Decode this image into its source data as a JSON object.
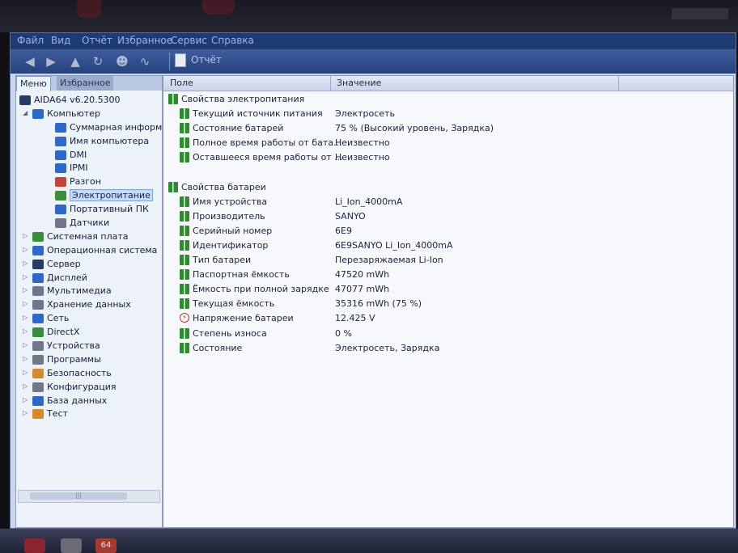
{
  "window": {
    "menu": [
      "Файл",
      "Вид",
      "Отчёт",
      "Избранное",
      "Сервис",
      "Справка"
    ],
    "toolbar": {
      "report_label": "Отчёт"
    }
  },
  "left_panel": {
    "tabs": [
      "Меню",
      "Избранное"
    ],
    "tree": [
      {
        "label": "AIDA64 v6.20.5300",
        "level": 0,
        "expander": "",
        "icon": "aida64-icon",
        "color": "#263b63"
      },
      {
        "label": "Компьютер",
        "level": 1,
        "expander": "◢",
        "icon": "computer-icon",
        "color": "#2f68c6"
      },
      {
        "label": "Суммарная информация",
        "level": 2,
        "expander": "",
        "icon": "summary-icon",
        "color": "#2f68c6"
      },
      {
        "label": "Имя компьютера",
        "level": 2,
        "expander": "",
        "icon": "computer-name-icon",
        "color": "#2f68c6"
      },
      {
        "label": "DMI",
        "level": 2,
        "expander": "",
        "icon": "dmi-icon",
        "color": "#2f68c6"
      },
      {
        "label": "IPMI",
        "level": 2,
        "expander": "",
        "icon": "ipmi-icon",
        "color": "#2f68c6"
      },
      {
        "label": "Разгон",
        "level": 2,
        "expander": "",
        "icon": "overclock-icon",
        "color": "#c3443b"
      },
      {
        "label": "Электропитание",
        "level": 2,
        "expander": "",
        "icon": "power-icon",
        "color": "#3a8d3b",
        "selected": true
      },
      {
        "label": "Портативный ПК",
        "level": 2,
        "expander": "",
        "icon": "laptop-icon",
        "color": "#2f68c6"
      },
      {
        "label": "Датчики",
        "level": 2,
        "expander": "",
        "icon": "sensor-icon",
        "color": "#6f7788"
      },
      {
        "label": "Системная плата",
        "level": 1,
        "expander": "▷",
        "icon": "motherboard-icon",
        "color": "#3a8d3b"
      },
      {
        "label": "Операционная система",
        "level": 1,
        "expander": "▷",
        "icon": "windows-icon",
        "color": "#2f68c6"
      },
      {
        "label": "Сервер",
        "level": 1,
        "expander": "▷",
        "icon": "server-icon",
        "color": "#263b63"
      },
      {
        "label": "Дисплей",
        "level": 1,
        "expander": "▷",
        "icon": "display-icon",
        "color": "#2f68c6"
      },
      {
        "label": "Мультимедиа",
        "level": 1,
        "expander": "▷",
        "icon": "multimedia-icon",
        "color": "#6f7788"
      },
      {
        "label": "Хранение данных",
        "level": 1,
        "expander": "▷",
        "icon": "storage-icon",
        "color": "#6f7788"
      },
      {
        "label": "Сеть",
        "level": 1,
        "expander": "▷",
        "icon": "network-icon",
        "color": "#2f68c6"
      },
      {
        "label": "DirectX",
        "level": 1,
        "expander": "▷",
        "icon": "directx-icon",
        "color": "#3a8d3b"
      },
      {
        "label": "Устройства",
        "level": 1,
        "expander": "▷",
        "icon": "devices-icon",
        "color": "#6f7788"
      },
      {
        "label": "Программы",
        "level": 1,
        "expander": "▷",
        "icon": "programs-icon",
        "color": "#6f7788"
      },
      {
        "label": "Безопасность",
        "level": 1,
        "expander": "▷",
        "icon": "security-icon",
        "color": "#d28a2a"
      },
      {
        "label": "Конфигурация",
        "level": 1,
        "expander": "▷",
        "icon": "config-icon",
        "color": "#6f7788"
      },
      {
        "label": "База данных",
        "level": 1,
        "expander": "▷",
        "icon": "database-icon",
        "color": "#2f68c6"
      },
      {
        "label": "Тест",
        "level": 1,
        "expander": "▷",
        "icon": "test-icon",
        "color": "#d28a2a"
      }
    ]
  },
  "right_panel": {
    "columns": {
      "field": "Поле",
      "value": "Значение"
    },
    "rows": [
      {
        "type": "group",
        "field": "Свойства электропитания",
        "value": "",
        "icon": "battery-icon"
      },
      {
        "type": "item",
        "field": "Текущий источник питания",
        "value": "Электросеть",
        "icon": "battery-icon"
      },
      {
        "type": "item",
        "field": "Состояние батарей",
        "value": "75 % (Высокий уровень, Зарядка)",
        "icon": "battery-icon"
      },
      {
        "type": "item",
        "field": "Полное время работы от бата...",
        "value": "Неизвестно",
        "icon": "battery-icon"
      },
      {
        "type": "item",
        "field": "Оставшееся время работы от ...",
        "value": "Неизвестно",
        "icon": "battery-icon"
      },
      {
        "type": "blank",
        "field": "",
        "value": "",
        "icon": ""
      },
      {
        "type": "group",
        "field": "Свойства батареи",
        "value": "",
        "icon": "battery-icon"
      },
      {
        "type": "item",
        "field": "Имя устройства",
        "value": "Li_Ion_4000mA",
        "icon": "battery-icon"
      },
      {
        "type": "item",
        "field": "Производитель",
        "value": "SANYO",
        "icon": "battery-icon"
      },
      {
        "type": "item",
        "field": "Серийный номер",
        "value": "6E9",
        "icon": "battery-icon"
      },
      {
        "type": "item",
        "field": "Идентификатор",
        "value": "6E9SANYO Li_Ion_4000mA",
        "icon": "battery-icon"
      },
      {
        "type": "item",
        "field": "Тип батареи",
        "value": "Перезаряжаемая Li-Ion",
        "icon": "battery-icon"
      },
      {
        "type": "item",
        "field": "Паспортная ёмкость",
        "value": "47520 mWh",
        "icon": "battery-icon"
      },
      {
        "type": "item",
        "field": "Ёмкость при полной зарядке",
        "value": "47077 mWh",
        "icon": "battery-icon"
      },
      {
        "type": "item",
        "field": "Текущая ёмкость",
        "value": "35316 mWh  (75 %)",
        "icon": "battery-icon"
      },
      {
        "type": "item",
        "field": "Напряжение батареи",
        "value": "12.425 V",
        "icon": "voltage-icon"
      },
      {
        "type": "item",
        "field": "Степень износа",
        "value": "0 %",
        "icon": "battery-icon"
      },
      {
        "type": "item",
        "field": "Состояние",
        "value": "Электросеть, Зарядка",
        "icon": "battery-icon"
      }
    ]
  },
  "taskbar": {
    "aida_label": "64"
  }
}
